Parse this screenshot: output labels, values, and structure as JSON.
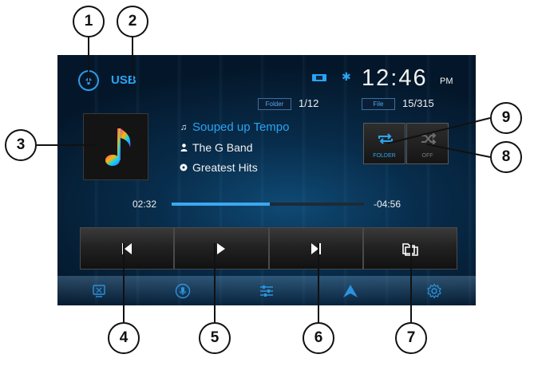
{
  "header": {
    "source": "USB",
    "clock_time": "12:46",
    "clock_ampm": "PM"
  },
  "counters": {
    "folder_tag": "Folder",
    "folder_value": "1/12",
    "file_tag": "File",
    "file_value": "15/315"
  },
  "track": {
    "title": "Souped up Tempo",
    "artist": "The G Band",
    "album": "Greatest Hits"
  },
  "mode_buttons": {
    "repeat_label": "FOLDER",
    "shuffle_label": "OFF"
  },
  "playback": {
    "elapsed": "02:32",
    "remaining": "-04:56",
    "progress": 0.51
  },
  "icons": {
    "back": "back-arrow-icon",
    "usb": "usb-icon",
    "bluetooth": "bluetooth-icon",
    "note": "music-note-icon",
    "person": "person-icon",
    "disc": "disc-icon",
    "repeat": "repeat-icon",
    "shuffle": "shuffle-icon",
    "prev": "previous-track-icon",
    "play": "play-icon",
    "next": "next-track-icon",
    "folder": "folder-icon",
    "display": "display-icon",
    "mic": "microphone-icon",
    "eq": "equalizer-icon",
    "up": "up-arrow-icon",
    "settings": "settings-gear-icon"
  },
  "callouts": [
    "1",
    "2",
    "3",
    "4",
    "5",
    "6",
    "7",
    "8",
    "9"
  ],
  "colors": {
    "accent": "#2aa4f4",
    "progress": "#3da7ef",
    "text": "#f0f0f0"
  }
}
